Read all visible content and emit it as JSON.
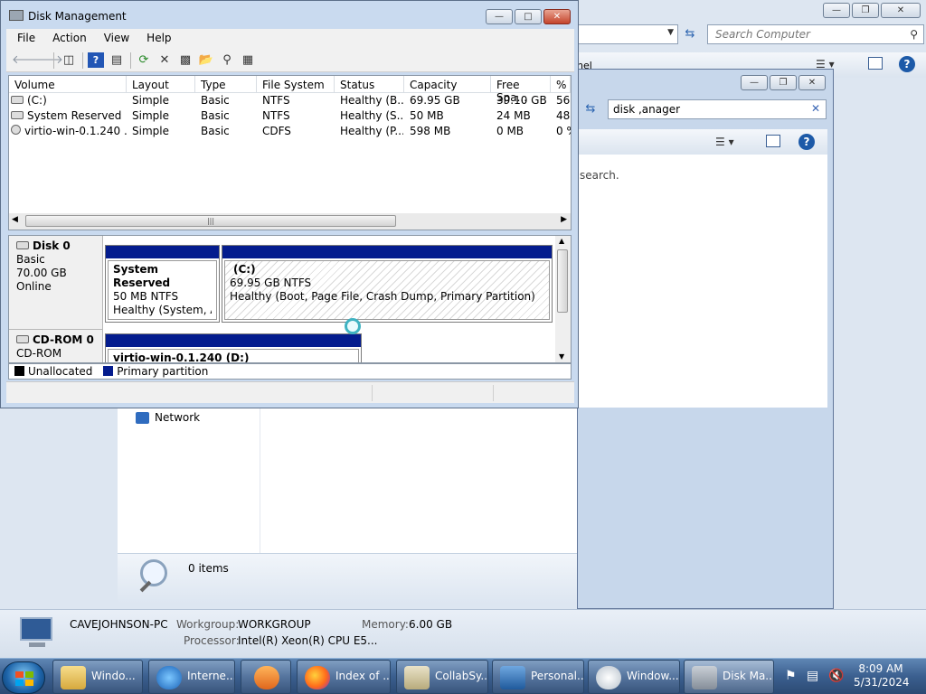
{
  "computer": {
    "search_placeholder": "Search Computer",
    "toolbar_fragment": "nel",
    "network_label": "Network",
    "status_count": "0 items",
    "details": {
      "pc_name": "CAVEJOHNSON-PC",
      "workgroup_label": "Workgroup:",
      "workgroup_value": "WORKGROUP",
      "memory_label": "Memory:",
      "memory_value": "6.00 GB",
      "processor_label": "Processor:",
      "processor_value": "Intel(R) Xeon(R) CPU E5..."
    }
  },
  "search_window": {
    "query": "disk ,anager",
    "body_fragment": "search."
  },
  "disk_mgmt": {
    "title": "Disk Management",
    "menu": [
      "File",
      "Action",
      "View",
      "Help"
    ],
    "columns": [
      "Volume",
      "Layout",
      "Type",
      "File System",
      "Status",
      "Capacity",
      "Free Spa...",
      "% F"
    ],
    "rows": [
      {
        "volume": "(C:)",
        "layout": "Simple",
        "type": "Basic",
        "fs": "NTFS",
        "status": "Healthy (B...",
        "capacity": "69.95 GB",
        "free": "39.10 GB",
        "pct": "56"
      },
      {
        "volume": "System Reserved",
        "layout": "Simple",
        "type": "Basic",
        "fs": "NTFS",
        "status": "Healthy (S...",
        "capacity": "50 MB",
        "free": "24 MB",
        "pct": "48"
      },
      {
        "volume": "virtio-win-0.1.240 ...",
        "layout": "Simple",
        "type": "Basic",
        "fs": "CDFS",
        "status": "Healthy (P...",
        "capacity": "598 MB",
        "free": "0 MB",
        "pct": "0 %"
      }
    ],
    "disk0": {
      "name": "Disk 0",
      "type": "Basic",
      "size": "70.00 GB",
      "state": "Online",
      "partitions": [
        {
          "name": "System Reserved",
          "size": "50 MB NTFS",
          "status": "Healthy (System, Acti"
        },
        {
          "name": "(C:)",
          "size": "69.95 GB NTFS",
          "status": "Healthy (Boot, Page File, Crash Dump, Primary Partition)"
        }
      ]
    },
    "cdrom0": {
      "name": "CD-ROM 0",
      "type": "CD-ROM",
      "partition": "virtio-win-0.1.240  (D:)"
    },
    "legend": {
      "unallocated": "Unallocated",
      "primary": "Primary partition"
    },
    "colors": {
      "unallocated": "#000000",
      "primary": "#041c8e"
    }
  },
  "taskbar": {
    "items": [
      {
        "label": "Windo...",
        "icon": "folder-icon"
      },
      {
        "label": "Interne...",
        "icon": "ie-icon"
      },
      {
        "label": "",
        "icon": "media-player-icon"
      },
      {
        "label": "Index of ...",
        "icon": "firefox-icon"
      },
      {
        "label": "CollabSy...",
        "icon": "app-icon"
      },
      {
        "label": "Personal...",
        "icon": "monitor-icon"
      },
      {
        "label": "Window...",
        "icon": "cd-icon"
      },
      {
        "label": "Disk Ma...",
        "icon": "disk-mgmt-icon"
      }
    ],
    "clock_time": "8:09 AM",
    "clock_date": "5/31/2024"
  }
}
